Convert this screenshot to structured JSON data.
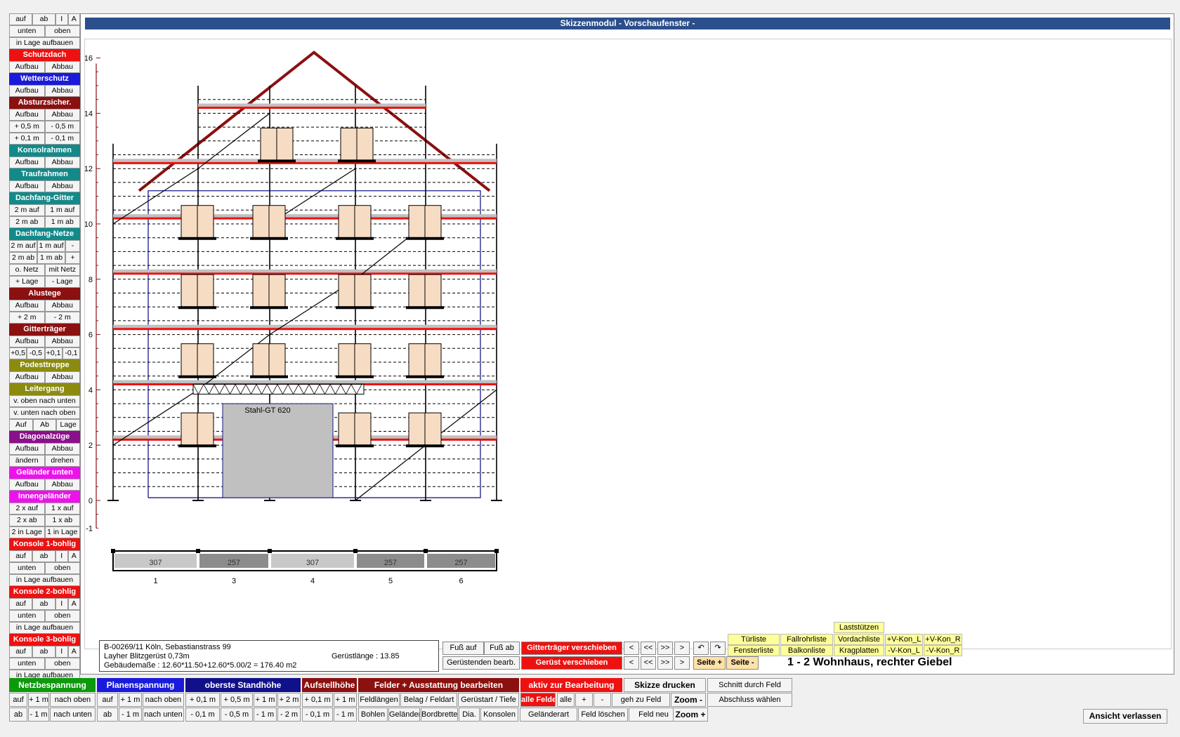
{
  "window_title": "Skizzenmodul  - Vorschaufenster -",
  "left_panel": [
    {
      "type": "row",
      "buttons": [
        "auf",
        "ab",
        "I",
        "A"
      ]
    },
    {
      "type": "row",
      "buttons": [
        "unten",
        "oben"
      ]
    },
    {
      "type": "row",
      "buttons": [
        "in Lage aufbauen"
      ]
    },
    {
      "type": "head",
      "label": "Schutzdach",
      "color": "#ee1111"
    },
    {
      "type": "row",
      "buttons": [
        "Aufbau",
        "Abbau"
      ]
    },
    {
      "type": "head",
      "label": "Wetterschutz",
      "color": "#1a1adc"
    },
    {
      "type": "row",
      "buttons": [
        "Aufbau",
        "Abbau"
      ]
    },
    {
      "type": "head",
      "label": "Absturzsicher.",
      "color": "#8b1010"
    },
    {
      "type": "row",
      "buttons": [
        "Aufbau",
        "Abbau"
      ]
    },
    {
      "type": "row",
      "buttons": [
        "+ 0,5 m",
        "- 0,5 m"
      ]
    },
    {
      "type": "row",
      "buttons": [
        "+ 0,1 m",
        "- 0,1 m"
      ]
    },
    {
      "type": "head",
      "label": "Konsolrahmen",
      "color": "#138a8a"
    },
    {
      "type": "row",
      "buttons": [
        "Aufbau",
        "Abbau"
      ]
    },
    {
      "type": "head",
      "label": "Traufrahmen",
      "color": "#138a8a"
    },
    {
      "type": "row",
      "buttons": [
        "Aufbau",
        "Abbau"
      ]
    },
    {
      "type": "head",
      "label": "Dachfang-Gitter",
      "color": "#138a8a"
    },
    {
      "type": "row",
      "buttons": [
        "2 m auf",
        "1 m auf"
      ]
    },
    {
      "type": "row",
      "buttons": [
        "2 m ab",
        "1 m ab"
      ]
    },
    {
      "type": "head",
      "label": "Dachfang-Netze",
      "color": "#138a8a"
    },
    {
      "type": "row",
      "buttons": [
        "2 m auf",
        "1 m auf",
        "-"
      ]
    },
    {
      "type": "row",
      "buttons": [
        "2 m ab",
        "1 m ab",
        "+"
      ]
    },
    {
      "type": "row",
      "buttons": [
        "o. Netz",
        "mit Netz"
      ]
    },
    {
      "type": "row",
      "buttons": [
        "+ Lage",
        "- Lage"
      ]
    },
    {
      "type": "head",
      "label": "Alustege",
      "color": "#8b1010"
    },
    {
      "type": "row",
      "buttons": [
        "Aufbau",
        "Abbau"
      ]
    },
    {
      "type": "row",
      "buttons": [
        "+ 2 m",
        "- 2 m"
      ]
    },
    {
      "type": "head",
      "label": "Gitterträger",
      "color": "#8b1010"
    },
    {
      "type": "row",
      "buttons": [
        "Aufbau",
        "Abbau"
      ]
    },
    {
      "type": "row",
      "buttons": [
        "+0,5",
        "-0,5",
        "+0,1",
        "-0,1"
      ]
    },
    {
      "type": "head",
      "label": "Podesttreppe",
      "color": "#8b8b10"
    },
    {
      "type": "row",
      "buttons": [
        "Aufbau",
        "Abbau"
      ]
    },
    {
      "type": "head",
      "label": "Leitergang",
      "color": "#8b8b10"
    },
    {
      "type": "row",
      "buttons": [
        "v. oben nach unten"
      ]
    },
    {
      "type": "row",
      "buttons": [
        "v. unten nach oben"
      ]
    },
    {
      "type": "row",
      "buttons": [
        "Auf",
        "Ab",
        "Lage"
      ]
    },
    {
      "type": "head",
      "label": "Diagonalzüge",
      "color": "#8b108b"
    },
    {
      "type": "row",
      "buttons": [
        "Aufbau",
        "Abbau"
      ]
    },
    {
      "type": "row",
      "buttons": [
        "ändern",
        "drehen"
      ]
    },
    {
      "type": "head",
      "label": "Geländer unten",
      "color": "#ee11ee"
    },
    {
      "type": "row",
      "buttons": [
        "Aufbau",
        "Abbau"
      ]
    },
    {
      "type": "head",
      "label": "Innengeländer",
      "color": "#ee11ee"
    },
    {
      "type": "row",
      "buttons": [
        "2 x auf",
        "1 x auf"
      ]
    },
    {
      "type": "row",
      "buttons": [
        "2 x ab",
        "1 x ab"
      ]
    },
    {
      "type": "row",
      "buttons": [
        "2 in Lage",
        "1 in Lage"
      ]
    },
    {
      "type": "head",
      "label": "Konsole 1-bohlig",
      "color": "#ee1111"
    },
    {
      "type": "row",
      "buttons": [
        "auf",
        "ab",
        "I",
        "A"
      ]
    },
    {
      "type": "row",
      "buttons": [
        "unten",
        "oben"
      ]
    },
    {
      "type": "row",
      "buttons": [
        "in Lage aufbauen"
      ]
    },
    {
      "type": "head",
      "label": "Konsole 2-bohlig",
      "color": "#ee1111"
    },
    {
      "type": "row",
      "buttons": [
        "auf",
        "ab",
        "I",
        "A"
      ]
    },
    {
      "type": "row",
      "buttons": [
        "unten",
        "oben"
      ]
    },
    {
      "type": "row",
      "buttons": [
        "in Lage aufbauen"
      ]
    },
    {
      "type": "head",
      "label": "Konsole 3-bohlig",
      "color": "#ee1111"
    },
    {
      "type": "row",
      "buttons": [
        "auf",
        "ab",
        "I",
        "A"
      ]
    },
    {
      "type": "row",
      "buttons": [
        "unten",
        "oben"
      ]
    },
    {
      "type": "row",
      "buttons": [
        "in Lage aufbauen"
      ]
    }
  ],
  "drawing": {
    "scale_labels": [
      "16",
      "14",
      "12",
      "10",
      "8",
      "6",
      "4",
      "2",
      "0",
      "-1"
    ],
    "girder_label": "Stahl-GT 620",
    "plan_segments": [
      "307",
      "257",
      "307",
      "257",
      "257"
    ],
    "plan_field_numbers": [
      "1",
      "3",
      "4",
      "5",
      "6"
    ]
  },
  "info": {
    "line1": "B-00269/11  Köln, Sebastianstrass 99",
    "line2": "Layher Blitzgerüst 0,73m",
    "line3": "Gebäudemaße :  12.60*11.50+12.60*5.00/2  =  176.40 m2",
    "length": "Gerüstlänge :  13.85"
  },
  "controls": {
    "fuss_auf": "Fuß auf",
    "fuss_ab": "Fuß ab",
    "geruestenden": "Gerüstenden bearb.",
    "gt_verschieben": "Gitterträger verschieben",
    "geruest_verschieben": "Gerüst verschieben",
    "nav": [
      "<",
      "<<",
      ">>",
      ">"
    ],
    "rotate_left": "↶",
    "rotate_right": "↷",
    "seite_plus": "Seite +",
    "seite_minus": "Seite -"
  },
  "lists": {
    "laststuetzen": "Laststützen",
    "tuerliste": "Türliste",
    "fallrohrliste": "Fallrohrliste",
    "vordachliste": "Vordachliste",
    "vkon_l_plus": "+V-Kon_L",
    "vkon_r_plus": "+V-Kon_R",
    "fensterliste": "Fensterliste",
    "balkonliste": "Balkonliste",
    "kragplatten": "Kragplatten",
    "vkon_l_minus": "-V-Kon_L",
    "vkon_r_minus": "-V-Kon_R"
  },
  "view_title": "1 - 2  Wohnhaus, rechter Giebel",
  "toolbar": {
    "netzbespannung": "Netzbespannung",
    "planenspannung": "Planenspannung",
    "oberste_standhoehe": "oberste Standhöhe",
    "aufstellhoehe": "Aufstellhöhe",
    "felder_ausstattung": "Felder + Ausstattung bearbeiten",
    "aktiv_bearbeitung": "aktiv zur Bearbeitung",
    "skizze_drucken": "Skizze drucken",
    "schnitt_feld": "Schnitt durch Feld",
    "row2": [
      "auf",
      "+ 1 m",
      "nach oben",
      "auf",
      "+ 1 m",
      "nach oben",
      "+ 0,1 m",
      "+ 0,5 m",
      "+ 1 m",
      "+ 2 m",
      "+ 0,1 m",
      "+ 1 m",
      "Feldlängen",
      "Belag / Feldart",
      "Gerüstart / Tiefe",
      "alle Felder",
      "alle",
      "+",
      "-",
      "geh zu Feld",
      "Zoom  -",
      "Abschluss wählen"
    ],
    "row3": [
      "ab",
      "- 1 m",
      "nach unten",
      "ab",
      "- 1 m",
      "nach unten",
      "- 0,1 m",
      "- 0,5 m",
      "- 1 m",
      "- 2 m",
      "- 0,1 m",
      "- 1 m",
      "Bohlen",
      "Geländer",
      "Bordbretter",
      "Dia.",
      "Konsolen",
      "Geländerart",
      "Feld löschen",
      "Feld neu",
      "Zoom  +"
    ],
    "exit": "Ansicht verlassen"
  },
  "colors": {
    "roof": "#8b1010",
    "deck_red": "#ee1111",
    "deck_grey": "#c0c0c0",
    "window_fill": "#f7dcc4",
    "title_bar": "#2b4f8c"
  }
}
